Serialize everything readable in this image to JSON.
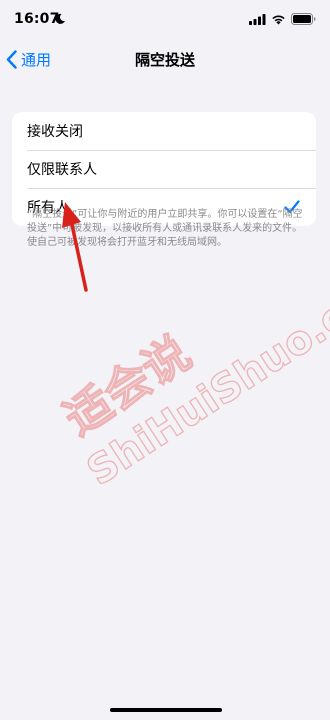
{
  "status_bar": {
    "time": "16:07",
    "icons": [
      "moon-icon",
      "cellular-signal-icon",
      "wifi-icon",
      "battery-icon"
    ]
  },
  "nav": {
    "back_label": "通用",
    "title": "隔空投送"
  },
  "options": [
    {
      "label": "接收关闭",
      "selected": false
    },
    {
      "label": "仅限联系人",
      "selected": false
    },
    {
      "label": "所有人",
      "selected": true
    }
  ],
  "footnote": "“隔空投送”可让你与附近的用户立即共享。你可以设置在“隔空投送”中可被发现，以接收所有人或通讯录联系人发来的文件。使自己可被发现将会打开蓝牙和无线局域网。",
  "watermark": {
    "text_cn": "适会说",
    "text_url": "ShiHuiShuo.com"
  },
  "colors": {
    "accent": "#007aff",
    "background": "#f2f2f7",
    "watermark": "#e8403a",
    "annotation_arrow": "#d8211b"
  }
}
